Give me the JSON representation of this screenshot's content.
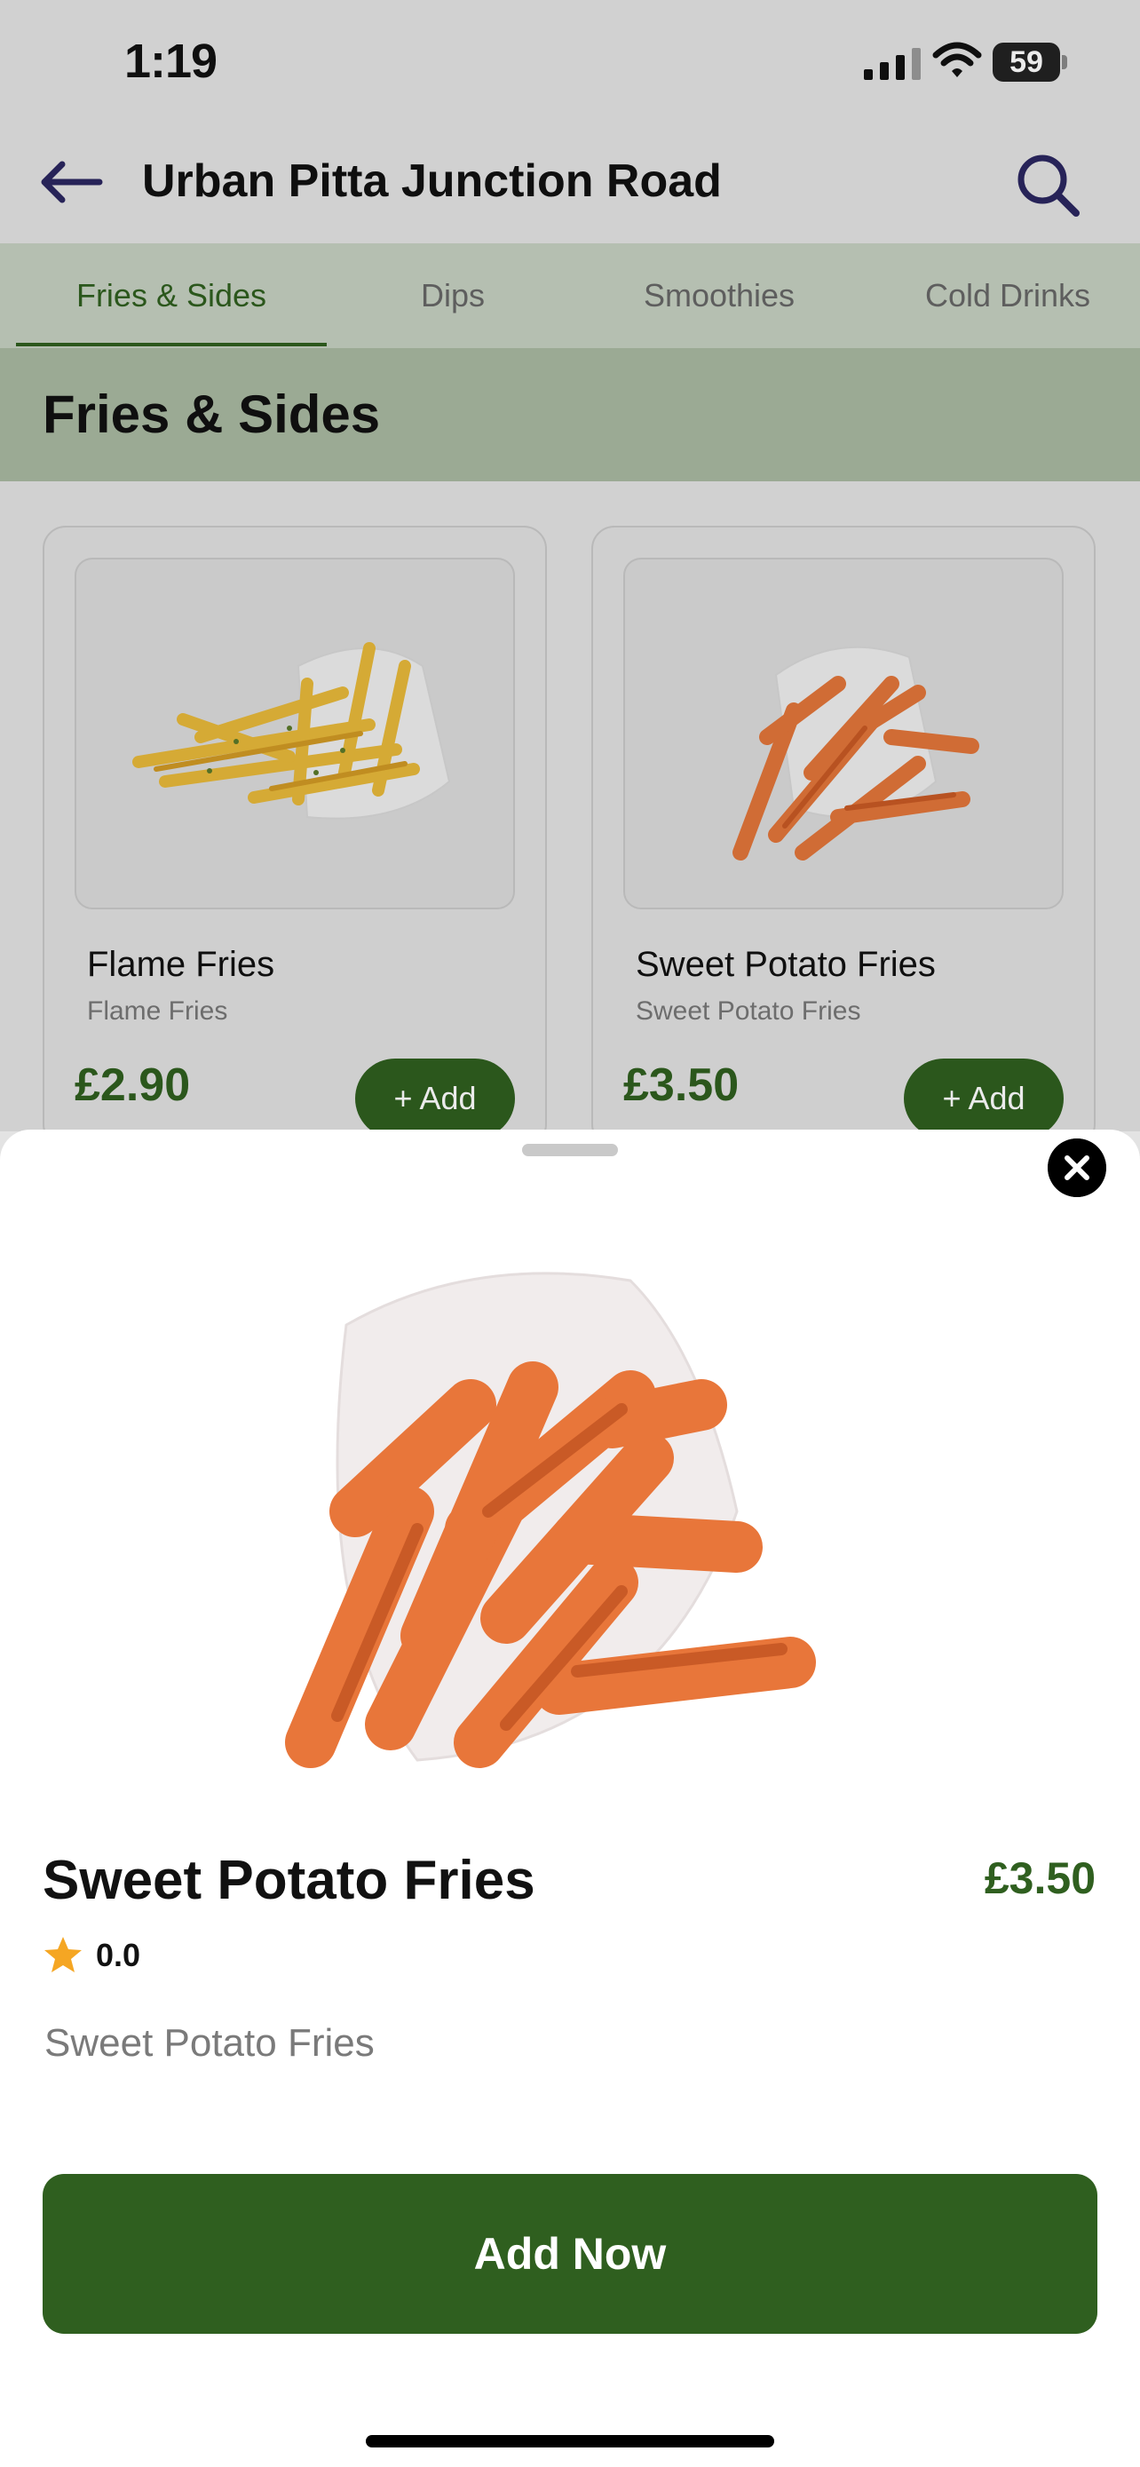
{
  "status_bar": {
    "time": "1:19",
    "battery_level": "59",
    "icons": [
      "signal-icon",
      "wifi-icon",
      "battery-icon"
    ]
  },
  "header": {
    "title": "Urban Pitta Junction Road",
    "icons": [
      "back-arrow-icon",
      "search-icon"
    ]
  },
  "tabs": [
    {
      "label": "Fries & Sides",
      "active": true
    },
    {
      "label": "Dips",
      "active": false
    },
    {
      "label": "Smoothies",
      "active": false
    },
    {
      "label": "Cold Drinks",
      "active": false
    }
  ],
  "section": {
    "title": "Fries & Sides"
  },
  "products": [
    {
      "name": "Flame Fries",
      "description": "Flame Fries",
      "price": "£2.90",
      "add_label": "+ Add"
    },
    {
      "name": "Sweet Potato Fries",
      "description": "Sweet Potato Fries",
      "price": "£3.50",
      "add_label": "+ Add"
    }
  ],
  "detail_sheet": {
    "name": "Sweet Potato Fries",
    "price": "£3.50",
    "rating": "0.0",
    "description": "Sweet Potato Fries",
    "add_now_label": "Add Now",
    "icons": [
      "close-icon",
      "star-icon"
    ]
  },
  "colors": {
    "accent": "#2f5f1f",
    "tab_bar": "#c5d0c0",
    "section_header": "#a9b9a1",
    "star": "#f5a623"
  }
}
